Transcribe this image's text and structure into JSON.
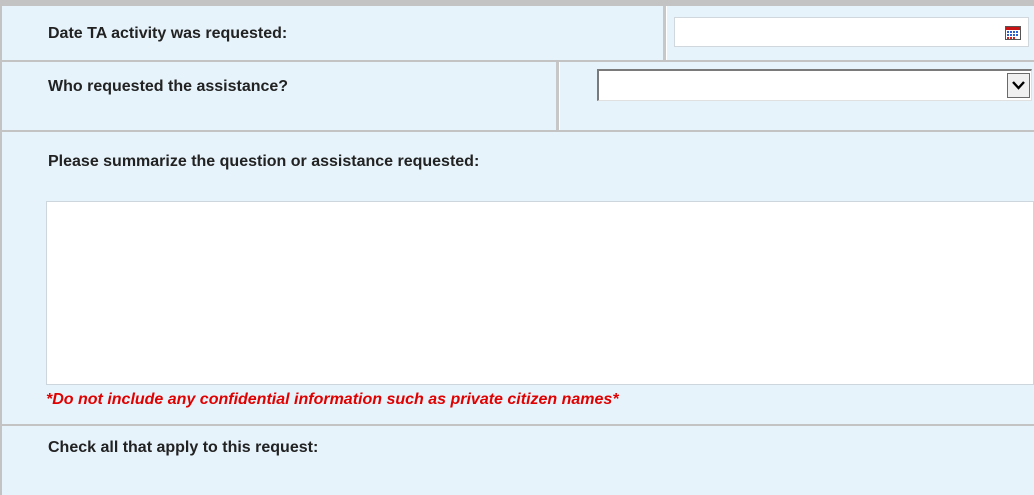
{
  "form": {
    "date_requested": {
      "label": "Date TA activity was requested:",
      "value": ""
    },
    "requester": {
      "label": "Who requested the assistance?",
      "selected": ""
    },
    "summary": {
      "label": "Please summarize the question or assistance requested:",
      "value": "",
      "warning": "*Do not include any confidential information such as private citizen names*"
    },
    "check_all": {
      "label": "Check all that apply to this request:"
    }
  },
  "icons": {
    "calendar": "calendar-icon",
    "dropdown": "chevron-down-icon"
  },
  "colors": {
    "background": "#e6f3fb",
    "border": "#c3c3c3",
    "warning": "#e00000"
  }
}
